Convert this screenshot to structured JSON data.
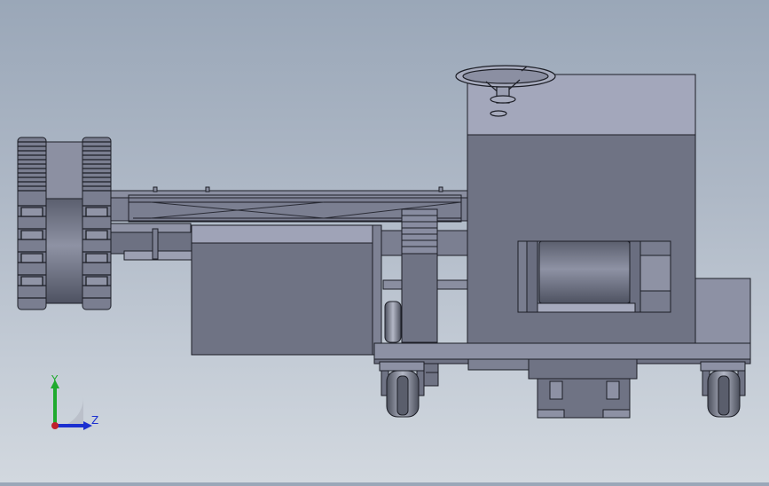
{
  "viewport": {
    "model": "machine-assembly-side-view",
    "background_top": "#9aa7b8",
    "background_bottom": "#d2d8df",
    "body_color": "#6f7384",
    "top_face_color": "#a3a7bb",
    "edge_color": "#1c1e26"
  },
  "triad": {
    "y_label": "Y",
    "z_label": "Z",
    "y_color": "#1faa2e",
    "z_color": "#1b2fd0",
    "origin_color": "#c0202a"
  }
}
